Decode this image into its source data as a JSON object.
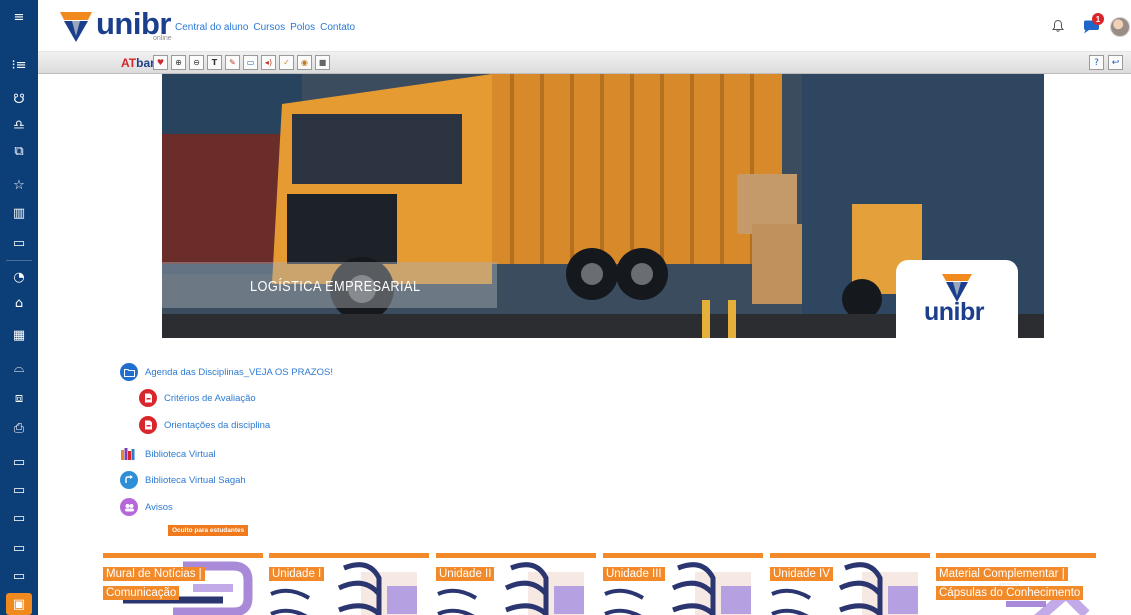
{
  "brand": {
    "logo_text": "unibr",
    "logo_sub": "online"
  },
  "topnav": [
    "Central do aluno",
    "Cursos",
    "Polos",
    "Contato"
  ],
  "notifications": {
    "chat_badge": "1"
  },
  "atbar": {
    "at": "AT",
    "bar": "bar",
    "tools": [
      "heart-icon",
      "zoom-in-icon",
      "zoom-out-icon",
      "font-icon",
      "paint-icon",
      "dictionary-icon",
      "speech-icon",
      "spellcheck-icon",
      "color-icon",
      "reset-icon"
    ],
    "right_tools": [
      "help-icon",
      "exit-icon"
    ]
  },
  "banner": {
    "title": "LOGÍSTICA EMPRESARIAL",
    "logo_text": "unibr"
  },
  "items": [
    {
      "label": "Agenda das Disciplinas_VEJA OS PRAZOS!",
      "icon": "folder-icon",
      "color": "#1e6fd0"
    },
    {
      "label": "Critérios de Avaliação",
      "icon": "pdf-icon",
      "color": "#d9262c"
    },
    {
      "label": "Orientações da disciplina",
      "icon": "pdf-icon",
      "color": "#d9262c"
    },
    {
      "label": "Biblioteca Virtual",
      "icon": "books-icon",
      "color": "#e08a28"
    },
    {
      "label": "Biblioteca Virtual Sagah",
      "icon": "external-link-icon",
      "color": "#2f8fd6"
    },
    {
      "label": "Avisos",
      "icon": "forum-icon",
      "color": "#b668d8"
    }
  ],
  "hidden_tag": "Oculto para estudantes",
  "tiles": [
    {
      "label": "Mural de Notícias | Comunicação"
    },
    {
      "label": "Unidade I"
    },
    {
      "label": "Unidade II"
    },
    {
      "label": "Unidade III"
    },
    {
      "label": "Unidade IV"
    },
    {
      "label": "Material Complementar | Cápsulas do Conhecimento"
    }
  ],
  "sidebar": {
    "icons": [
      "menu-icon",
      "list-icon",
      "users-icon",
      "people-icon",
      "layers-icon",
      "star-icon",
      "book-icon",
      "folder-icon",
      "dashboard-icon",
      "home-icon",
      "calendar-icon",
      "graduation-icon",
      "books-icon",
      "clipboard-icon",
      "folder-icon",
      "folder-icon",
      "folder-icon",
      "folder-icon",
      "folder-icon",
      "lock-icon"
    ]
  },
  "colors": {
    "sidebar": "#0c3e78",
    "accent": "#f28a2a",
    "link": "#2d7bd1",
    "brand": "#1b3f8c"
  }
}
